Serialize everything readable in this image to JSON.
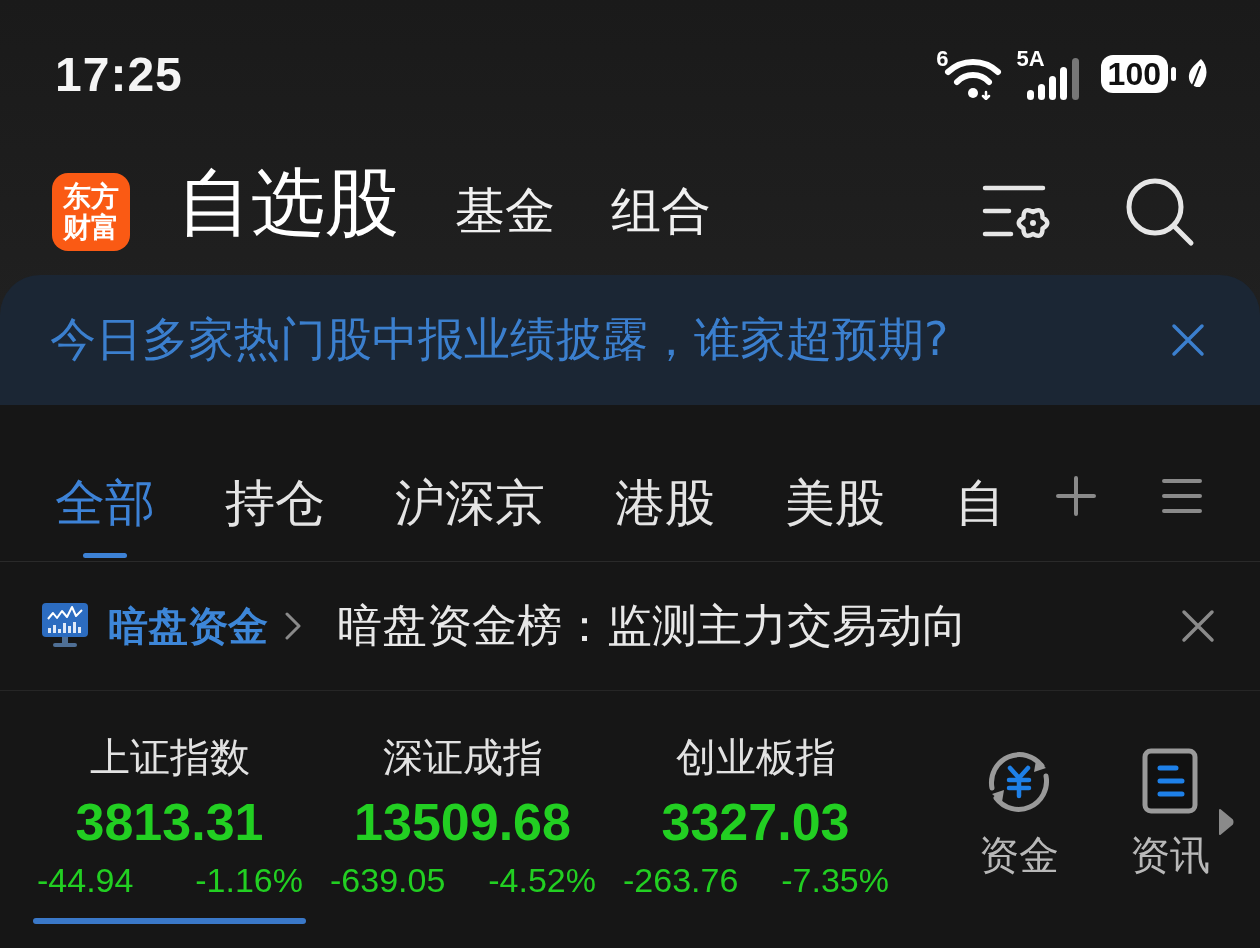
{
  "status_bar": {
    "time": "17:25",
    "wifi_label": "6",
    "signal_label": "5A",
    "battery": "100"
  },
  "header": {
    "logo": "东方财富",
    "tabs": [
      {
        "label": "自选股",
        "selected": true
      },
      {
        "label": "基金",
        "selected": false
      },
      {
        "label": "组合",
        "selected": false
      }
    ]
  },
  "notice": {
    "text": "今日多家热门股中报业绩披露，谁家超预期?"
  },
  "group_tabs": [
    {
      "label": "全部",
      "selected": true
    },
    {
      "label": "持仓",
      "selected": false
    },
    {
      "label": "沪深京",
      "selected": false
    },
    {
      "label": "港股",
      "selected": false
    },
    {
      "label": "美股",
      "selected": false
    },
    {
      "label": "自",
      "selected": false
    }
  ],
  "promo": {
    "tag": "暗盘资金",
    "text": "暗盘资金榜：监测主力交易动向"
  },
  "indices": [
    {
      "name": "上证指数",
      "value": "3813.31",
      "change": "-44.94",
      "percent": "-1.16%",
      "selected": true
    },
    {
      "name": "深证成指",
      "value": "13509.68",
      "change": "-639.05",
      "percent": "-4.52%",
      "selected": false
    },
    {
      "name": "创业板指",
      "value": "3327.03",
      "change": "-263.76",
      "percent": "-7.35%",
      "selected": false
    }
  ],
  "shortcuts": [
    {
      "kind": "funds",
      "label": "资金"
    },
    {
      "kind": "news",
      "label": "资讯"
    }
  ]
}
